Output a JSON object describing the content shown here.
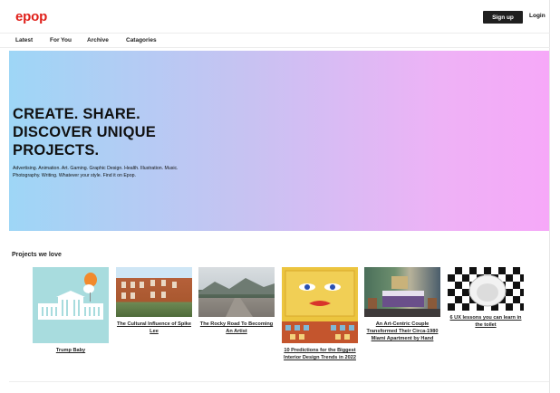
{
  "brand": {
    "logo_text": "epop",
    "color": "#e0201a"
  },
  "header": {
    "signup_label": "Sign up",
    "login_label": "Login"
  },
  "nav": {
    "items": [
      "Latest",
      "For You",
      "Archive",
      "Catagories"
    ]
  },
  "hero": {
    "title": "CREATE. SHARE. DISCOVER UNIQUE PROJECTS.",
    "subtitle": "Advertising. Animation. Art. Gaming. Graphic Design. Health. Illustration. Music. Photography. Writing. Whatever your style. Find it on Epop.",
    "gradient": [
      "#9ed6f6",
      "#f6a8f8"
    ]
  },
  "projects": {
    "heading": "Projects we love",
    "items": [
      {
        "title": "Trump Baby",
        "icon": "trump-baby-illustration"
      },
      {
        "title": "The Cultural Influence of Spike Lee",
        "icon": "brownstone-street-photo"
      },
      {
        "title": "The Rocky Road To Becoming An Artist",
        "icon": "mountain-road-photo"
      },
      {
        "title": "10 Predictions for the Biggest Interior Design Trends in 2022",
        "icon": "colorful-face-art"
      },
      {
        "title": "An Art-Centric Couple Transformed Their Circa-1980 Miami Apartment by Hand",
        "icon": "bedroom-interior-photo"
      },
      {
        "title": "6 UX lessons you can learn in the toilet",
        "icon": "checkered-sink-photo"
      }
    ]
  }
}
